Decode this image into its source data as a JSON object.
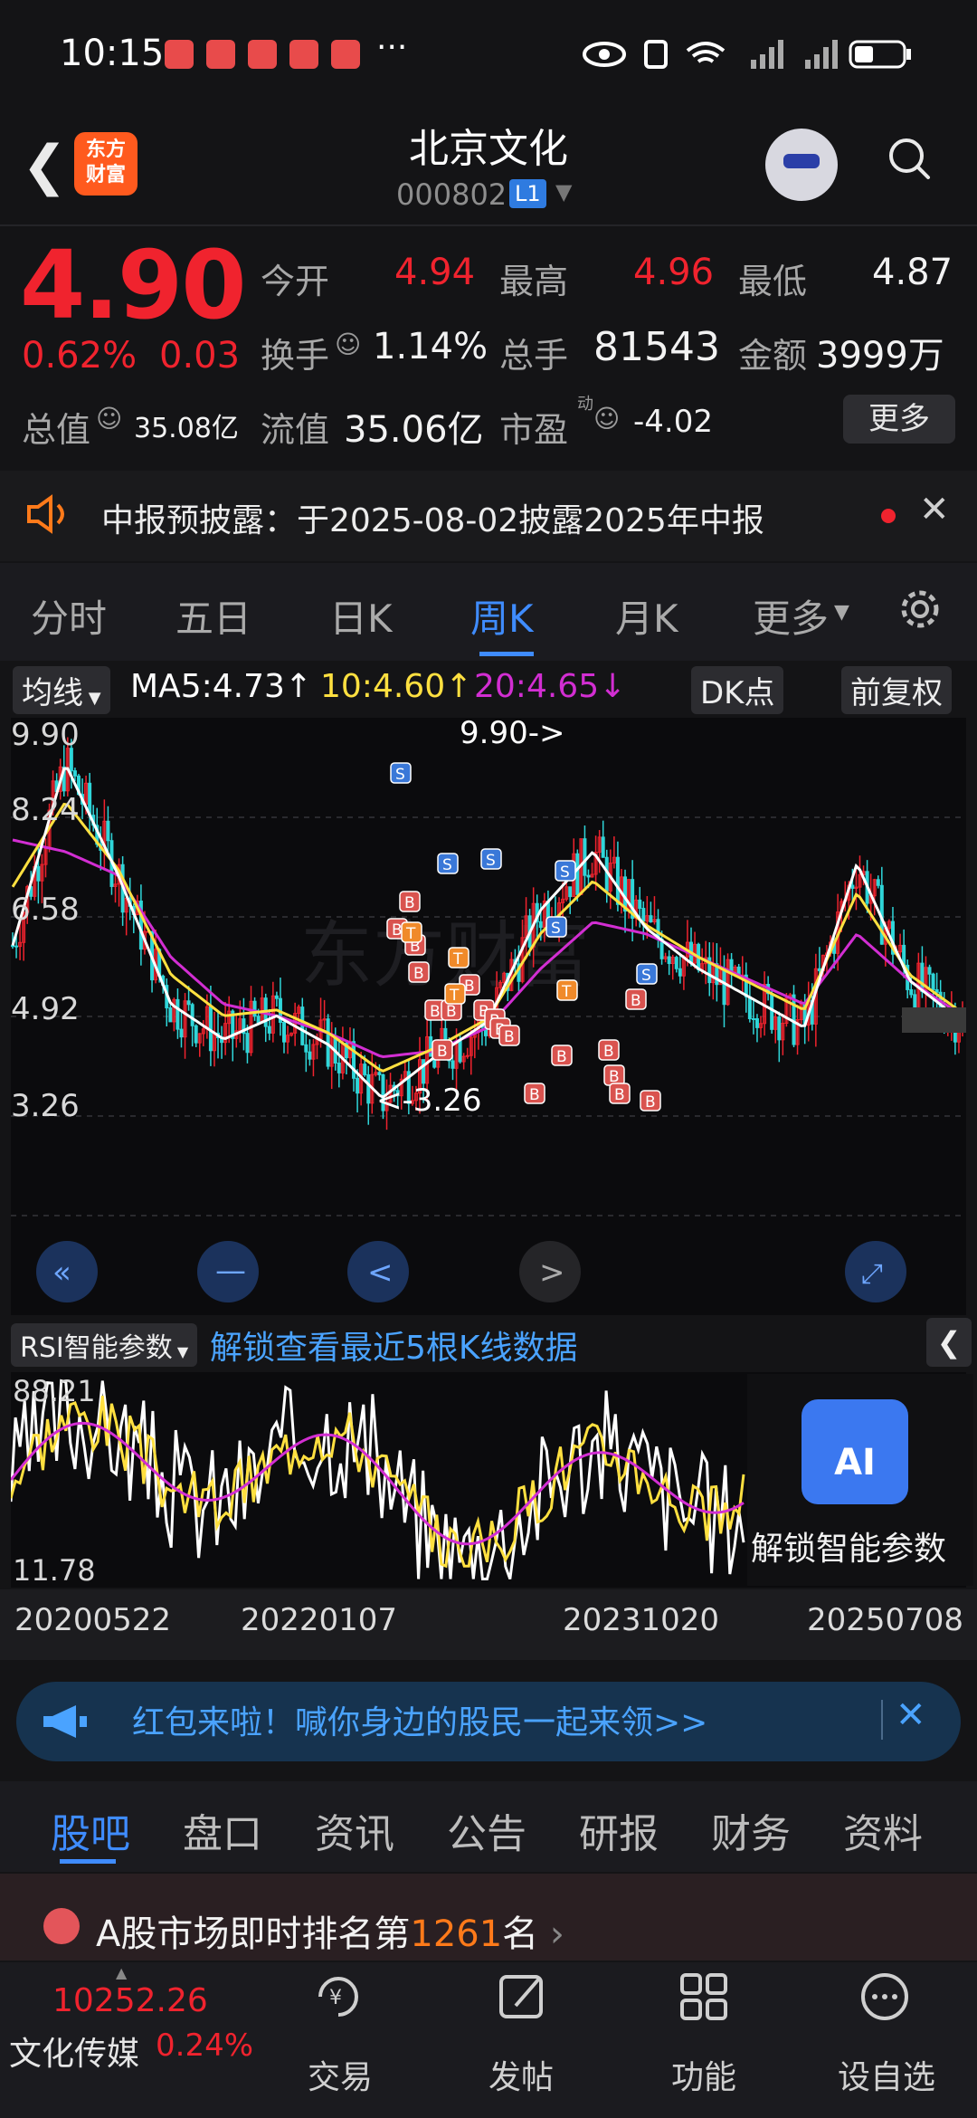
{
  "status_bar": {
    "time": "10:15",
    "extra": "···"
  },
  "header": {
    "title": "北京文化",
    "code": "000802",
    "level_badge": "L1"
  },
  "quote": {
    "price": "4.90",
    "change_pct": "0.62%",
    "change": "0.03",
    "open_label": "今开",
    "open": "4.94",
    "high_label": "最高",
    "high": "4.96",
    "low_label": "最低",
    "low": "4.87",
    "turnover_label": "换手",
    "turnover": "1.14%",
    "volume_label": "总手",
    "volume": "81543",
    "amount_label": "金额",
    "amount": "3999万",
    "mktcap_label": "总值",
    "mktcap": "35.08亿",
    "float_label": "流值",
    "float_cap": "35.06亿",
    "pe_label": "市盈",
    "pe_sup": "动",
    "pe": "-4.02",
    "more_label": "更多"
  },
  "announcement": {
    "text": "中报预披露：于2025-08-02披露2025年中报"
  },
  "tabs": [
    "分时",
    "五日",
    "日K",
    "周K",
    "月K",
    "更多"
  ],
  "ma": {
    "dropdown": "均线",
    "ma5": "MA5:4.73↑",
    "ma10": "10:4.60↑",
    "ma20": "20:4.65↓",
    "dk_label": "DK点",
    "adjust_label": "前复权"
  },
  "chart_labels": {
    "y_max": "9.90",
    "y_2": "8.24",
    "y_3": "6.58",
    "y_4": "4.92",
    "y_min": "3.26",
    "high_marker": "9.90->",
    "low_marker": "<-3.26"
  },
  "rsi": {
    "dropdown": "RSI智能参数",
    "unlock_text": "解锁查看最近5根K线数据",
    "max": "88.21",
    "min": "11.78",
    "ai_badge": "AI",
    "ai_unlock": "解锁智能参数"
  },
  "dates": [
    "20200522",
    "20220107",
    "20231020",
    "20250708"
  ],
  "banner": {
    "text": "红包来啦！喊你身边的股民一起来领>>"
  },
  "sub_tabs": [
    "股吧",
    "盘口",
    "资讯",
    "公告",
    "研报",
    "财务",
    "资料"
  ],
  "rank": {
    "prefix": "A股市场即时排名第",
    "number": "1261",
    "suffix": "名"
  },
  "bottom_nav": {
    "index_value": "10252.26",
    "index_name": "文化传媒",
    "index_pct": "0.24%",
    "items": [
      "交易",
      "发帖",
      "功能",
      "设自选"
    ]
  },
  "colors": {
    "up": "#f0232e",
    "down": "#2fd6d9",
    "accent": "#3f8cff",
    "ma5": "#ffffff",
    "ma10": "#ffe040",
    "ma20": "#d22ed2"
  },
  "chart_data": {
    "type": "candlestick",
    "y_range": [
      3.26,
      9.9
    ],
    "x_labels": [
      "20200522",
      "20220107",
      "20231020",
      "20250708"
    ],
    "ma5_close_approx": [
      6.2,
      9.3,
      7.4,
      5.2,
      4.6,
      5.0,
      4.5,
      3.6,
      4.3,
      4.9,
      6.8,
      7.8,
      6.5,
      5.8,
      5.3,
      4.8,
      7.6,
      5.6,
      4.9
    ],
    "ma20_approx": [
      8.0,
      7.8,
      7.4,
      6.0,
      5.2,
      5.0,
      4.7,
      4.3,
      4.4,
      4.8,
      5.8,
      6.6,
      6.4,
      6.0,
      5.6,
      5.2,
      6.4,
      5.6,
      5.0
    ],
    "rsi_range": [
      11.78,
      88.21
    ]
  }
}
